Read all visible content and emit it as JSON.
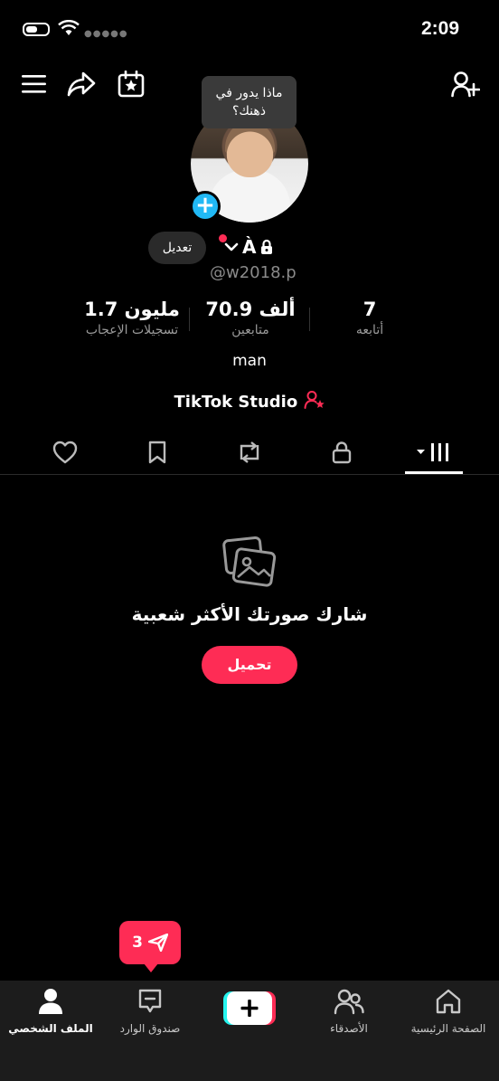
{
  "status_bar": {
    "time": "2:09"
  },
  "tooltip": {
    "text": "ماذا يدور في ذهنك؟"
  },
  "profile": {
    "edit_label": "تعديل",
    "display_name": "À",
    "username": "@w2018.p",
    "bio": "man",
    "studio_label": "TikTok Studio"
  },
  "stats": [
    {
      "value": "1.7 مليون",
      "label": "تسجيلات الإعجاب"
    },
    {
      "value": "70.9 ألف",
      "label": "متابعين"
    },
    {
      "value": "7",
      "label": "أتابعه"
    }
  ],
  "tabs": [
    "liked-icon",
    "favorites-icon",
    "reposts-icon",
    "private-icon",
    "videos-grid-icon"
  ],
  "empty_state": {
    "title": "شارك صورتك الأكثر شعبية",
    "button": "تحميل"
  },
  "inbox_bubble": {
    "count": "3"
  },
  "bottom_nav": {
    "profile": "الملف الشخصي",
    "inbox": "صندوق الوارد",
    "friends": "الأصدقاء",
    "home": "الصفحة الرئيسية"
  },
  "colors": {
    "accent": "#fe2c55",
    "blue": "#21b9f5",
    "background": "#000000",
    "navbar": "#1c1c1c"
  }
}
